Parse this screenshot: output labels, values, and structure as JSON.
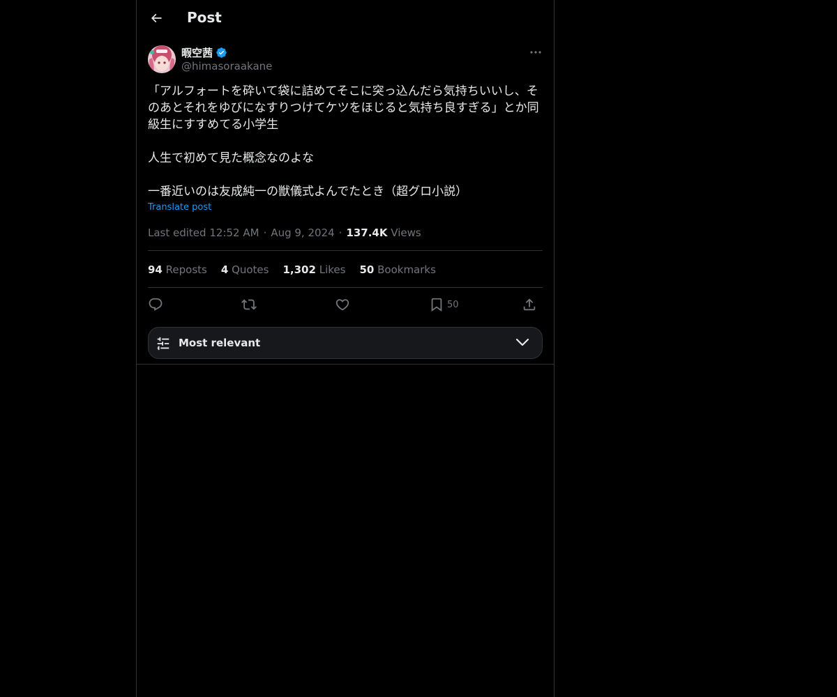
{
  "header": {
    "title": "Post"
  },
  "author": {
    "display_name": "暇空茜",
    "handle": "@himasoraakane",
    "verified": true
  },
  "post": {
    "paragraphs": [
      "「アルフォートを砕いて袋に詰めてそこに突っ込んだら気持ちいいし、そのあとそれをゆびになすりつけてケツをほじると気持ち良すぎる」とか同級生にすすめてる小学生",
      "人生で初めて見た概念なのよな",
      "一番近いのは友成純一の獣儀式よんでたとき（超グロ小説）"
    ],
    "translate_label": "Translate post"
  },
  "meta": {
    "edited_label": "Last edited 12:52 AM",
    "date": "Aug 9, 2024",
    "views_count": "137.4K",
    "views_label": "Views",
    "separator": "·"
  },
  "stats": {
    "reposts_count": "94",
    "reposts_label": "Reposts",
    "quotes_count": "4",
    "quotes_label": "Quotes",
    "likes_count": "1,302",
    "likes_label": "Likes",
    "bookmarks_count": "50",
    "bookmarks_label": "Bookmarks"
  },
  "actions": {
    "bookmark_count": "50"
  },
  "sort": {
    "label": "Most relevant"
  },
  "colors": {
    "background": "#000000",
    "text": "#e7e9ea",
    "muted": "#71767b",
    "accent": "#1d9bf0",
    "border": "#2f3336"
  },
  "icons": {
    "back": "arrow-left-icon",
    "verified": "verified-badge-icon",
    "more": "more-dots-icon",
    "reply": "reply-icon",
    "repost": "repost-icon",
    "like": "heart-icon",
    "bookmark": "bookmark-icon",
    "share": "share-icon",
    "sort": "sliders-icon",
    "chevron": "chevron-down-icon"
  }
}
